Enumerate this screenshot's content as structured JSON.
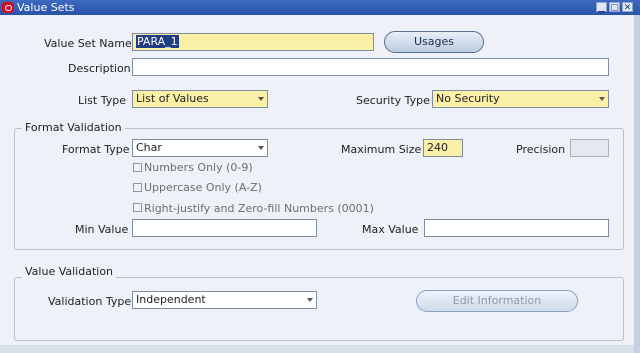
{
  "window": {
    "title": "Value Sets",
    "controls": [
      "minimize-icon",
      "maximize-icon",
      "close-icon"
    ]
  },
  "main": {
    "value_set_name_label": "Value Set Name",
    "value_set_name_value": "PARA_1",
    "usages_button": "Usages",
    "description_label": "Description",
    "description_value": "",
    "list_type_label": "List Type",
    "list_type_value": "List of Values",
    "security_type_label": "Security Type",
    "security_type_value": "No Security"
  },
  "format_validation": {
    "title": "Format Validation",
    "format_type_label": "Format Type",
    "format_type_value": "Char",
    "maximum_size_label": "Maximum Size",
    "maximum_size_value": "240",
    "precision_label": "Precision",
    "precision_value": "",
    "numbers_only_label": "Numbers Only (0-9)",
    "uppercase_only_label": "Uppercase Only (A-Z)",
    "right_justify_label": "Right-justify and Zero-fill Numbers (0001)",
    "min_value_label": "Min Value",
    "min_value": "",
    "max_value_label": "Max Value",
    "max_value": ""
  },
  "value_validation": {
    "title": "Value Validation",
    "validation_type_label": "Validation Type",
    "validation_type_value": "Independent",
    "edit_information_button": "Edit Information"
  },
  "colors": {
    "titlebar": "#2a53a8",
    "required_field": "#fbf0a8",
    "panel": "#eef2f8"
  }
}
